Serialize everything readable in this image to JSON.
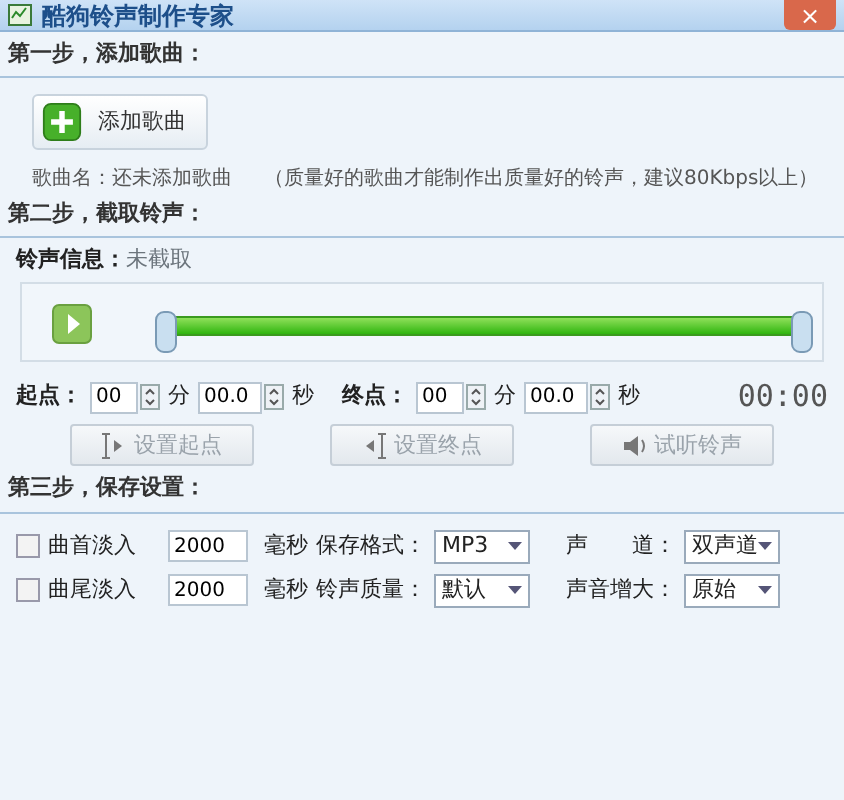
{
  "window": {
    "title": "酷狗铃声制作专家",
    "close": "×"
  },
  "step1": {
    "heading": "第一步，添加歌曲：",
    "add_button": "添加歌曲",
    "song_label": "歌曲名：还未添加歌曲",
    "hint": "（质量好的歌曲才能制作出质量好的铃声，建议80Kbps以上）"
  },
  "step2": {
    "heading": "第二步，截取铃声：",
    "info_label": "铃声信息：",
    "info_value": "未截取",
    "start_label": "起点：",
    "end_label": "终点：",
    "times": [
      {
        "min": "00",
        "min_unit": "分",
        "sec": "00.0",
        "sec_unit": "秒"
      },
      {
        "min": "00",
        "min_unit": "分",
        "sec": "00.0",
        "sec_unit": "秒"
      }
    ],
    "clock": "00:00",
    "buttons": [
      {
        "label": "设置起点",
        "kind": "start",
        "disabled": true
      },
      {
        "label": "设置终点",
        "kind": "end",
        "disabled": true
      },
      {
        "label": "试听铃声",
        "kind": "listen",
        "disabled": true
      }
    ]
  },
  "step3": {
    "heading": "第三步，保存设置：",
    "fades": [
      {
        "label": "曲首淡入",
        "checked": false,
        "value": "2000",
        "unit": "毫秒"
      },
      {
        "label": "曲尾淡入",
        "checked": false,
        "value": "2000",
        "unit": "毫秒"
      }
    ],
    "selects": [
      {
        "label": "保存格式：",
        "value": "MP3"
      },
      {
        "label": "声　　道：",
        "value": "双声道"
      },
      {
        "label": "铃声质量：",
        "value": "默认"
      },
      {
        "label": "声音增大：",
        "value": "原始"
      }
    ]
  }
}
